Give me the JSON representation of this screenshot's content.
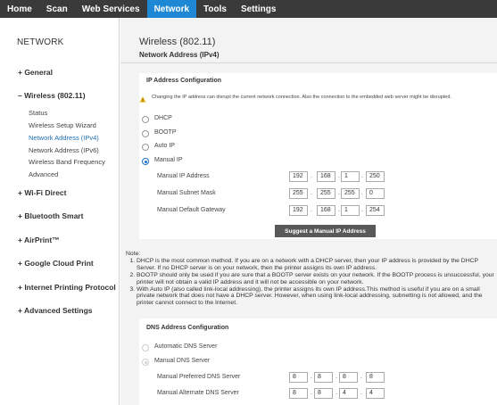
{
  "topnav": {
    "tabs": [
      {
        "label": "Home"
      },
      {
        "label": "Scan"
      },
      {
        "label": "Web Services"
      },
      {
        "label": "Network",
        "active": true
      },
      {
        "label": "Tools"
      },
      {
        "label": "Settings"
      }
    ]
  },
  "sidebar": {
    "title": "NETWORK",
    "items": [
      {
        "label": "+ General"
      },
      {
        "label": "– Wireless (802.11)"
      },
      {
        "label": "+ Wi-Fi Direct"
      },
      {
        "label": "+ Bluetooth Smart"
      },
      {
        "label": "+ AirPrint™"
      },
      {
        "label": "+ Google Cloud Print"
      },
      {
        "label": "+ Internet Printing Protocol"
      },
      {
        "label": "+ Advanced Settings"
      }
    ],
    "subitems": [
      {
        "label": "Status"
      },
      {
        "label": "Wireless Setup Wizard"
      },
      {
        "label": "Network Address (IPv4)",
        "active": true
      },
      {
        "label": "Network Address (IPv6)"
      },
      {
        "label": "Wireless Band Frequency"
      },
      {
        "label": "Advanced"
      }
    ]
  },
  "main": {
    "title": "Wireless (802.11)",
    "subtitle": "Network Address (IPv4)",
    "ip_section": {
      "header": "IP Address Configuration",
      "warning_icon": "warning-triangle-icon",
      "warning": "Changing the IP address can disrupt the current network connection. Also the connection to the embedded web server might be disrupted.",
      "options": [
        {
          "label": "DHCP",
          "checked": false
        },
        {
          "label": "BOOTP",
          "checked": false
        },
        {
          "label": "Auto IP",
          "checked": false
        },
        {
          "label": "Manual IP",
          "checked": true
        }
      ],
      "fields": [
        {
          "label": "Manual IP Address",
          "octets": [
            "192",
            "168",
            "1",
            "250"
          ]
        },
        {
          "label": "Manual Subnet Mask",
          "octets": [
            "255",
            "255",
            "255",
            "0"
          ]
        },
        {
          "label": "Manual Default Gateway",
          "octets": [
            "192",
            "168",
            "1",
            "254"
          ]
        }
      ],
      "suggest_button": "Suggest a Manual IP Address"
    },
    "note": {
      "title": "Note:",
      "items": [
        "DHCP is the most common method. If you are on a network with a DHCP server, then your IP address is provided by the DHCP Server. If no DHCP server is on your network, then the printer assigns its own IP address.",
        "BOOTP should only be used if you are sure that a BOOTP server exists on your network. If the BOOTP process is unsuccessful, your printer will not obtain a valid IP address and it will not be accessible on your network.",
        "With Auto IP (also called link-local addressing), the printer assigns its own IP address.This method is useful if you are on a small private network that does not have a DHCP server. However, when using link-local addressing, subnetting is not allowed, and the printer cannot connect to the Internet."
      ]
    },
    "dns_section": {
      "header": "DNS Address Configuration",
      "options": [
        {
          "label": "Automatic DNS Server",
          "checked": false
        },
        {
          "label": "Manual DNS Server",
          "checked": true
        }
      ],
      "fields": [
        {
          "label": "Manual Preferred DNS Server",
          "octets": [
            "8",
            "8",
            "8",
            "8"
          ]
        },
        {
          "label": "Manual Alternate DNS Server",
          "octets": [
            "8",
            "8",
            "4",
            "4"
          ]
        }
      ]
    }
  }
}
